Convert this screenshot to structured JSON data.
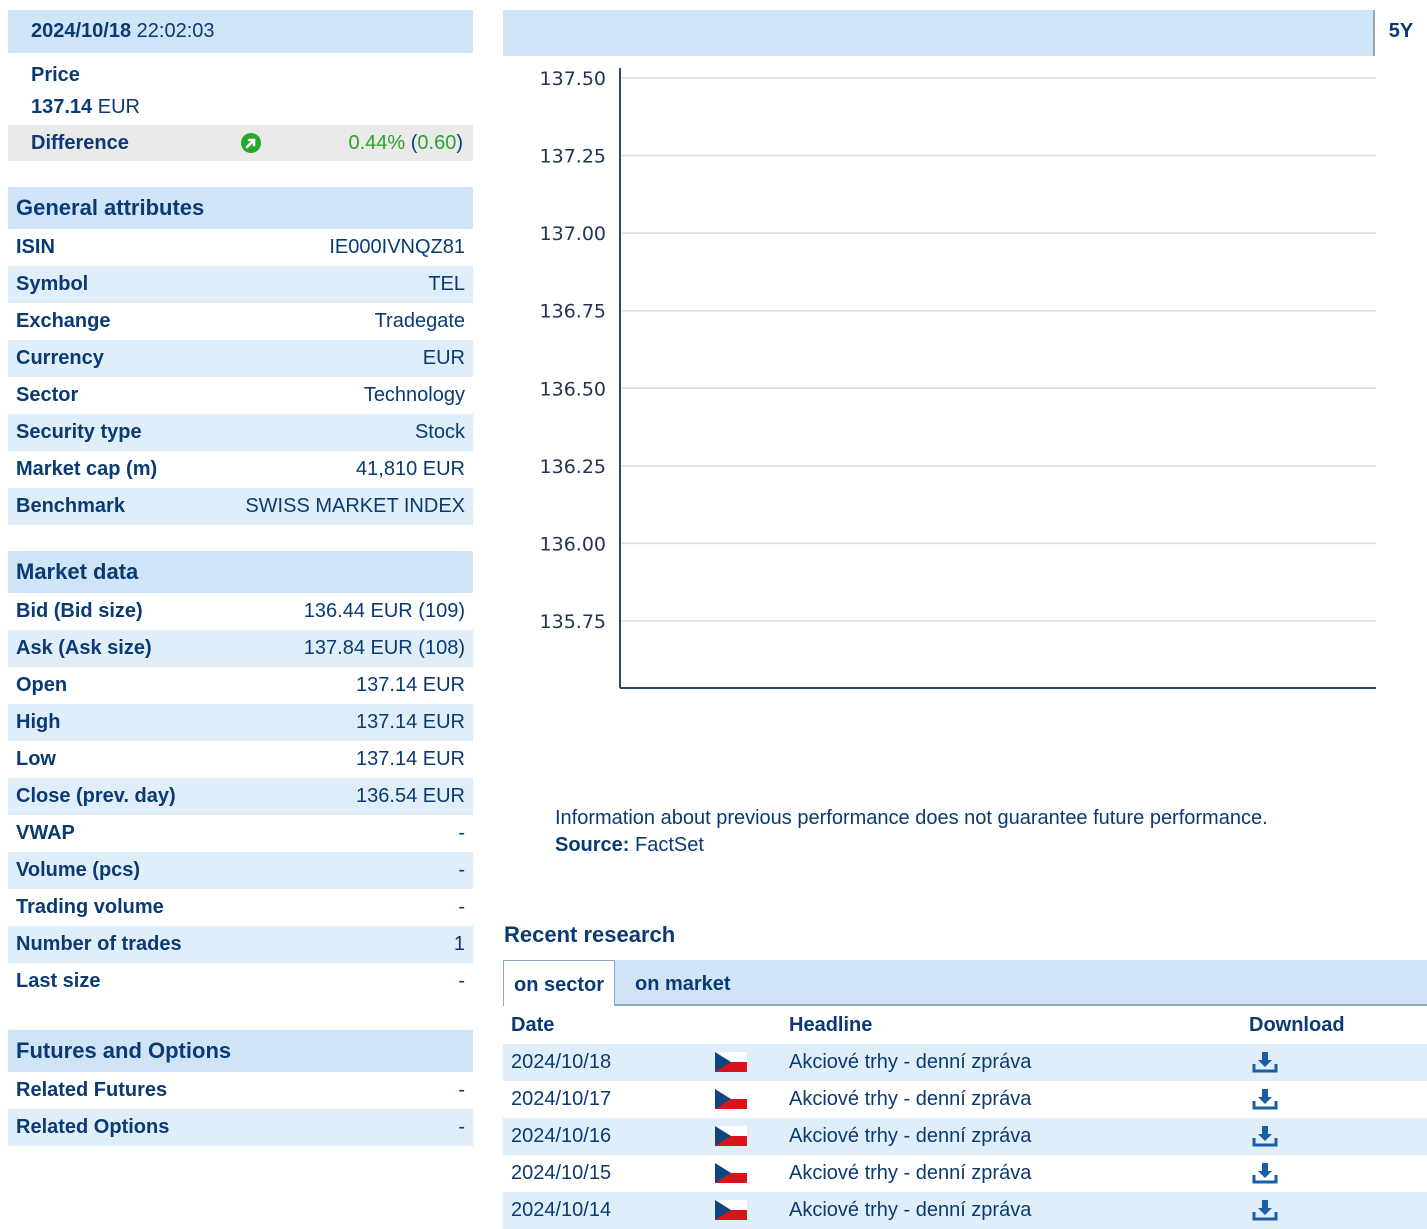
{
  "quote": {
    "date": "2024/10/18",
    "time": "22:02:03",
    "price_label": "Price",
    "price_value": "137.14",
    "price_currency": "EUR",
    "difference_label": "Difference",
    "difference_pct": "0.44%",
    "difference_abs": "0.60"
  },
  "general": {
    "title": "General attributes",
    "rows": [
      {
        "k": "ISIN",
        "v": "IE000IVNQZ81"
      },
      {
        "k": "Symbol",
        "v": "TEL"
      },
      {
        "k": "Exchange",
        "v": "Tradegate"
      },
      {
        "k": "Currency",
        "v": "EUR"
      },
      {
        "k": "Sector",
        "v": "Technology"
      },
      {
        "k": "Security type",
        "v": "Stock"
      },
      {
        "k": "Market cap (m)",
        "v": "41,810 EUR"
      },
      {
        "k": "Benchmark",
        "v": "SWISS MARKET INDEX"
      }
    ]
  },
  "market": {
    "title": "Market data",
    "rows": [
      {
        "k": "Bid (Bid size)",
        "v": "136.44 EUR (109)"
      },
      {
        "k": "Ask (Ask size)",
        "v": "137.84 EUR (108)"
      },
      {
        "k": "Open",
        "v": "137.14 EUR"
      },
      {
        "k": "High",
        "v": "137.14 EUR"
      },
      {
        "k": "Low",
        "v": "137.14 EUR"
      },
      {
        "k": "Close (prev. day)",
        "v": "136.54 EUR"
      },
      {
        "k": "VWAP",
        "v": "-"
      },
      {
        "k": "Volume (pcs)",
        "v": "-"
      },
      {
        "k": "Trading volume",
        "v": "-"
      },
      {
        "k": "Number of trades",
        "v": "1"
      },
      {
        "k": "Last size",
        "v": "-"
      }
    ]
  },
  "futures": {
    "title": "Futures and Options",
    "rows": [
      {
        "k": "Related Futures",
        "v": "-"
      },
      {
        "k": "Related Options",
        "v": "-"
      }
    ]
  },
  "chart_toolbar": {
    "period": "5Y"
  },
  "chart_data": {
    "type": "line",
    "title": "",
    "xlabel": "",
    "ylabel": "",
    "ylim": [
      135.75,
      137.5
    ],
    "yticks": [
      "137.50",
      "137.25",
      "137.00",
      "136.75",
      "136.50",
      "136.25",
      "136.00",
      "135.75"
    ],
    "grid": true,
    "series": []
  },
  "disclaimer": {
    "text": "Information about previous performance does not guarantee future performance.",
    "source_label": "Source:",
    "source_value": "FactSet"
  },
  "research": {
    "title": "Recent research",
    "tabs": [
      "on sector",
      "on market"
    ],
    "headers": {
      "date": "Date",
      "headline": "Headline",
      "download": "Download"
    },
    "rows": [
      {
        "date": "2024/10/18",
        "headline": "Akciové trhy - denní zpráva"
      },
      {
        "date": "2024/10/17",
        "headline": "Akciové trhy - denní zpráva"
      },
      {
        "date": "2024/10/16",
        "headline": "Akciové trhy - denní zpráva"
      },
      {
        "date": "2024/10/15",
        "headline": "Akciové trhy - denní zpráva"
      },
      {
        "date": "2024/10/14",
        "headline": "Akciové trhy - denní zpráva"
      }
    ]
  }
}
